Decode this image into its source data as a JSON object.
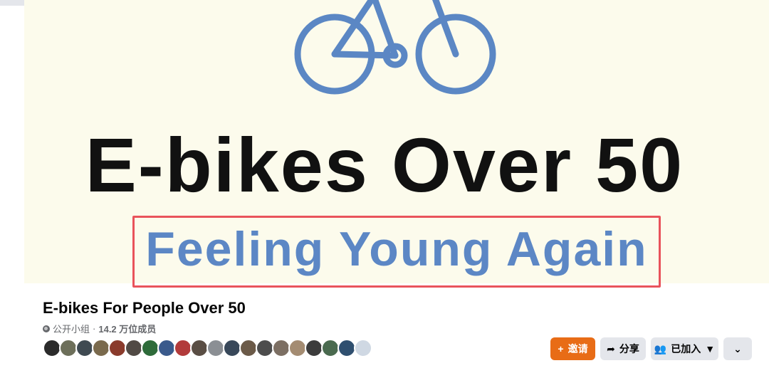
{
  "cover": {
    "headline": "E-bikes Over 50",
    "tagline": "Feeling Young Again"
  },
  "group": {
    "name": "E-bikes For People Over 50",
    "privacy": "公开小组",
    "separator": "·",
    "members_count": "14.2 万位成员"
  },
  "member_avatar_colors": [
    "#2b2b2b",
    "#6d6f5a",
    "#3f4a52",
    "#7a6a4d",
    "#8a3b2c",
    "#514a45",
    "#2e6b3a",
    "#3a5a8c",
    "#b23b3b",
    "#5a4e44",
    "#8b8f94",
    "#38485a",
    "#6b5a48",
    "#4d4d4d",
    "#7c6f63",
    "#a48c72",
    "#3c3c3c",
    "#4a6a4f",
    "#2f4f6f",
    "#cfd8e3"
  ],
  "actions": {
    "invite": "邀请",
    "share": "分享",
    "joined": "已加入"
  },
  "colors": {
    "accent": "#e86c16",
    "highlight_border": "#e9535b",
    "tagline": "#5c87c5",
    "bike": "#5b87c4"
  }
}
